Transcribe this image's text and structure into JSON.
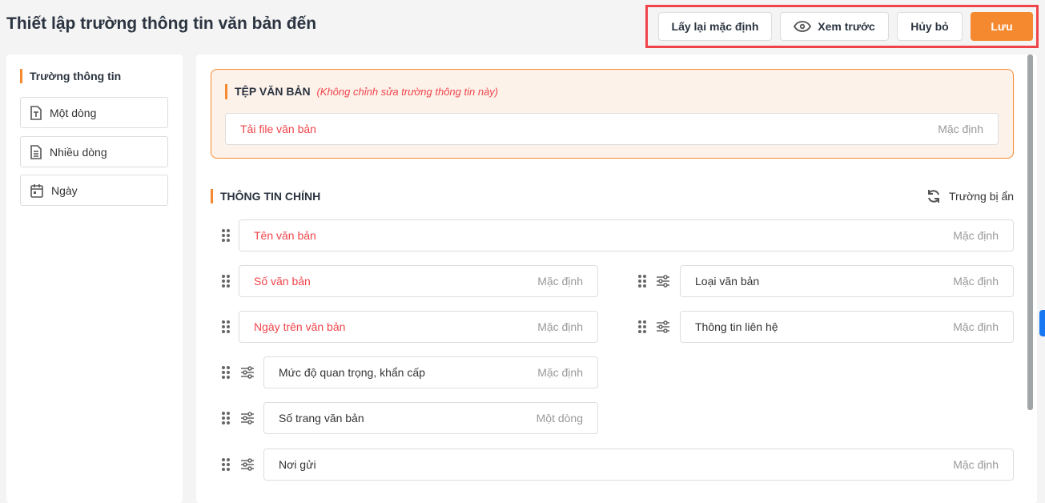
{
  "header": {
    "title": "Thiết lập trường thông tin văn bản đến",
    "buttons": {
      "reset": "Lấy lại mặc định",
      "preview": "Xem trước",
      "cancel": "Hủy bỏ",
      "save": "Lưu"
    }
  },
  "sidebar": {
    "heading": "Trường thông tin",
    "items": [
      {
        "label": "Một dòng",
        "icon": "text-file-icon"
      },
      {
        "label": "Nhiều dòng",
        "icon": "document-icon"
      },
      {
        "label": "Ngày",
        "icon": "calendar-icon"
      }
    ]
  },
  "file_section": {
    "title": "TỆP VĂN BẢN",
    "note": "(Không chỉnh sửa trường thông tin này)",
    "field": {
      "label": "Tải file văn bản",
      "type": "Mặc định"
    }
  },
  "main_section": {
    "title": "THÔNG TIN CHÍNH",
    "hidden_fields": "Trường bị ẩn",
    "fields": [
      {
        "label": "Tên văn bản",
        "type": "Mặc định",
        "required": true
      },
      {
        "label": "Số văn bản",
        "type": "Mặc định",
        "required": true
      },
      {
        "label": "Loại văn bản",
        "type": "Mặc định",
        "required": false
      },
      {
        "label": "Ngày trên văn bản",
        "type": "Mặc định",
        "required": true
      },
      {
        "label": "Thông tin liên hệ",
        "type": "Mặc định",
        "required": false
      },
      {
        "label": "Mức độ quan trọng, khẩn cấp",
        "type": "Mặc định",
        "required": false
      },
      {
        "label": "Số trang văn bản",
        "type": "Một dòng",
        "required": false
      },
      {
        "label": "Nơi gửi",
        "type": "Mặc định",
        "required": false
      }
    ]
  },
  "colors": {
    "accent": "#f5892f",
    "required": "#f0444a",
    "highlight": "#f0444a"
  }
}
